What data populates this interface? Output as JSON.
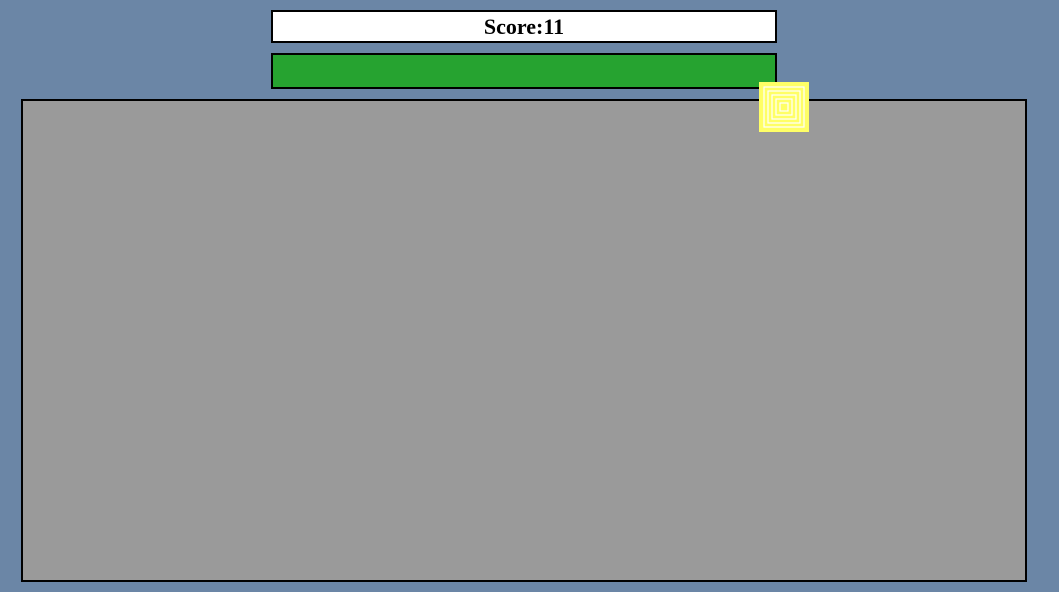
{
  "colors": {
    "background": "#6b86a6",
    "score_box": "#ffffff",
    "health_bar": "#26a330",
    "play_area": "#9a9a9a",
    "player_fill": "#ffff66",
    "player_rings": "#ffffff"
  },
  "hud": {
    "score_label": "Score:",
    "score_value": "11",
    "health_percent": 100
  },
  "player": {
    "icon": "concentric-square-icon"
  }
}
